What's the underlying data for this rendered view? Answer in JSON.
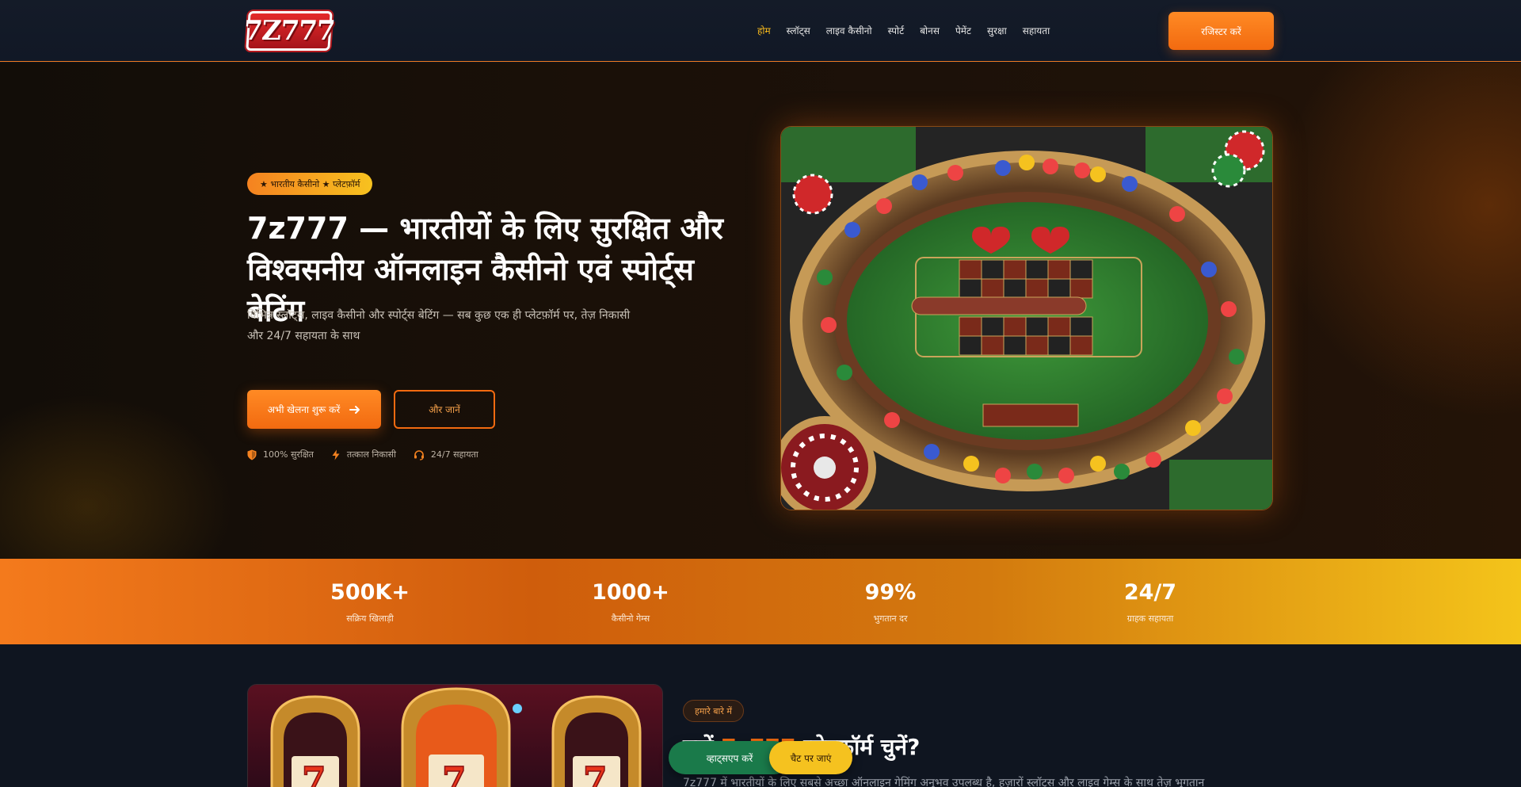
{
  "header": {
    "logo_text": "7Z777",
    "nav": [
      {
        "label": "होम",
        "active": true
      },
      {
        "label": "स्लॉट्स"
      },
      {
        "label": "लाइव कैसीनो"
      },
      {
        "label": "स्पोर्ट"
      },
      {
        "label": "बोनस"
      },
      {
        "label": "पेमेंट"
      },
      {
        "label": "सुरक्षा"
      },
      {
        "label": "सहायता"
      }
    ],
    "register_label": "रजिस्टर करें"
  },
  "hero": {
    "badge": "★ भारतीय कैसीनो ★ प्लेटफ़ॉर्म",
    "title": "7z777 — भारतीयों के लिए सुरक्षित और विश्वसनीय ऑनलाइन कैसीनो एवं स्पोर्ट्स बेटिंग",
    "description": "विभिन्न स्लॉट्स, लाइव कैसीनो और स्पोर्ट्स बेटिंग — सब कुछ एक ही प्लेटफ़ॉर्म पर, तेज़ निकासी और 24/7 सहायता के साथ",
    "play_label": "अभी खेलना शुरू करें",
    "more_label": "और जानें",
    "features": [
      {
        "icon": "shield-icon",
        "label": "100% सुरक्षित"
      },
      {
        "icon": "lightning-icon",
        "label": "तत्काल निकासी"
      },
      {
        "icon": "headset-icon",
        "label": "24/7 सहायता"
      }
    ]
  },
  "stats": [
    {
      "value": "500K+",
      "label": "सक्रिय खिलाड़ी"
    },
    {
      "value": "1000+",
      "label": "कैसीनो गेम्स"
    },
    {
      "value": "99%",
      "label": "भुगतान दर"
    },
    {
      "value": "24/7",
      "label": "ग्राहक सहायता"
    }
  ],
  "about": {
    "tag": "हमारे बारे में",
    "title_prefix": "क्यों",
    "title_accent": "7z777",
    "title_suffix": "प्लेटफ़ॉर्म चुनें?",
    "text": "7z777 में भारतीयों के लिए सबसे अच्छा ऑनलाइन गेमिंग अनुभव उपलब्ध है, हज़ारों स्लॉट्स और लाइव गेम्स के साथ तेज़ भुगतान"
  },
  "floating": {
    "whatsapp_label": "व्हाट्सएप करें",
    "telegram_label": "चैट पर जाएं"
  }
}
